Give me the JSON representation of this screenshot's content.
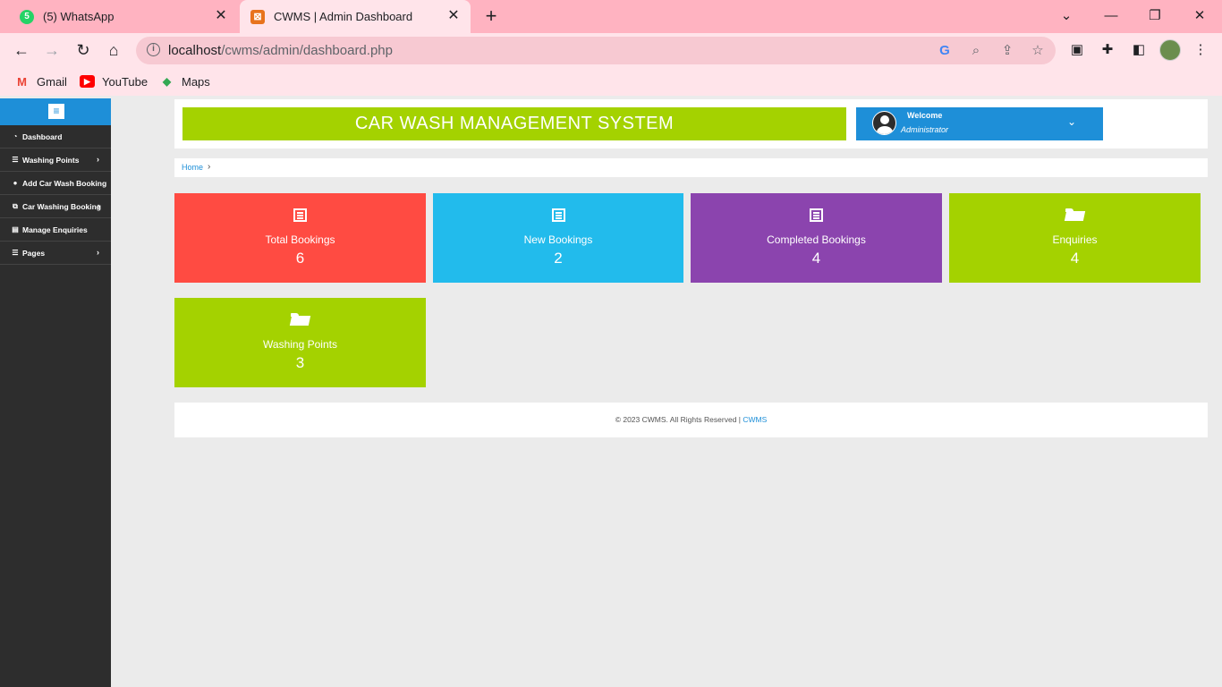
{
  "browser": {
    "tabs": [
      {
        "title": "(5) WhatsApp",
        "badge": "5"
      },
      {
        "title": "CWMS | Admin Dashboard"
      }
    ],
    "url_host": "localhost",
    "url_path": "/cwms/admin/dashboard.php",
    "bookmarks": [
      "Gmail",
      "YouTube",
      "Maps"
    ]
  },
  "sidebar": {
    "items": [
      {
        "label": "Dashboard",
        "icon": "dashboard-icon",
        "has_submenu": false
      },
      {
        "label": "Washing Points",
        "icon": "list-icon",
        "has_submenu": true
      },
      {
        "label": "Add Car Wash Booking",
        "icon": "user-icon",
        "has_submenu": false
      },
      {
        "label": "Car Washing Booking",
        "icon": "copy-icon",
        "has_submenu": true
      },
      {
        "label": "Manage Enquiries",
        "icon": "file-icon",
        "has_submenu": false
      },
      {
        "label": "Pages",
        "icon": "list-icon",
        "has_submenu": true
      }
    ]
  },
  "header": {
    "title": "CAR WASH MANAGEMENT SYSTEM",
    "welcome": "Welcome",
    "role": "Administrator"
  },
  "breadcrumb": {
    "home": "Home"
  },
  "cards": [
    {
      "label": "Total Bookings",
      "value": "6",
      "color": "#ff4b42",
      "icon": "list-icon"
    },
    {
      "label": "New Bookings",
      "value": "2",
      "color": "#22bbec",
      "icon": "list-icon"
    },
    {
      "label": "Completed Bookings",
      "value": "4",
      "color": "#8b44ae",
      "icon": "list-icon"
    },
    {
      "label": "Enquiries",
      "value": "4",
      "color": "#a4d200",
      "icon": "folder-open-icon"
    },
    {
      "label": "Washing Points",
      "value": "3",
      "color": "#a4d200",
      "icon": "folder-open-icon"
    }
  ],
  "footer": {
    "text": "© 2023 CWMS. All Rights Reserved | ",
    "link": "CWMS"
  },
  "colors": {
    "accent": "#1e8fd8",
    "title_green": "#a4d200",
    "sidebar_bg": "#2d2d2d"
  }
}
